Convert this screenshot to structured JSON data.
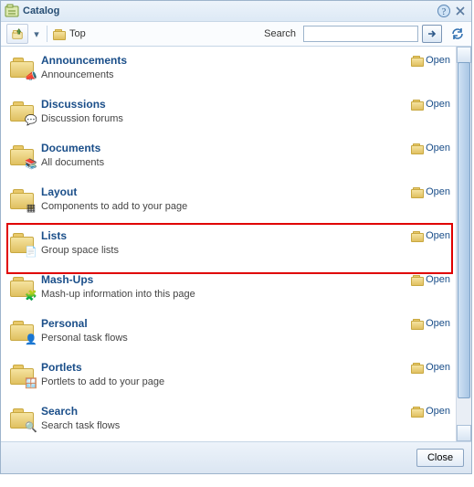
{
  "title": "Catalog",
  "toolbar": {
    "breadcrumb": "Top",
    "search_label": "Search",
    "search_value": "",
    "search_placeholder": ""
  },
  "open_label": "Open",
  "items": [
    {
      "name": "Announcements",
      "desc": "Announcements",
      "overlay": "📣",
      "highlighted": false
    },
    {
      "name": "Discussions",
      "desc": "Discussion forums",
      "overlay": "💬",
      "highlighted": false
    },
    {
      "name": "Documents",
      "desc": "All documents",
      "overlay": "📚",
      "highlighted": false
    },
    {
      "name": "Layout",
      "desc": "Components to add to your page",
      "overlay": "▦",
      "highlighted": false
    },
    {
      "name": "Lists",
      "desc": "Group space lists",
      "overlay": "📄",
      "highlighted": true
    },
    {
      "name": "Mash-Ups",
      "desc": "Mash-up information into this page",
      "overlay": "🧩",
      "highlighted": false
    },
    {
      "name": "Personal",
      "desc": "Personal task flows",
      "overlay": "👤",
      "highlighted": false
    },
    {
      "name": "Portlets",
      "desc": "Portlets to add to your page",
      "overlay": "🪟",
      "highlighted": false
    },
    {
      "name": "Search",
      "desc": "Search task flows",
      "overlay": "🔍",
      "highlighted": false
    }
  ],
  "buttons": {
    "close": "Close"
  }
}
